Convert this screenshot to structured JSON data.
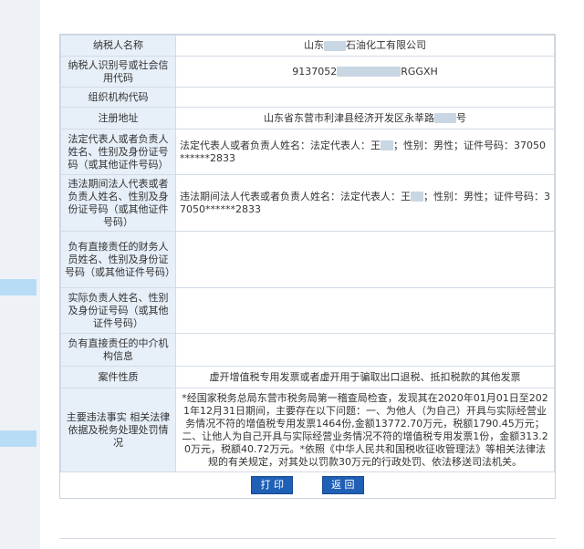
{
  "rows": [
    {
      "label": "纳税人名称",
      "value_a": "山东",
      "value_b": "石油化工有限公司"
    },
    {
      "label": "纳税人识别号或社会信用代码",
      "value_a": "9137052",
      "value_b": "RGGXH"
    },
    {
      "label": "组织机构代码",
      "value": ""
    },
    {
      "label": "注册地址",
      "value_a": "山东省东营市利津县经济开发区永莘路",
      "value_b": "号"
    },
    {
      "label": "法定代表人或者负责人姓名、性别及身份证号码（或其他证件号码）",
      "value_a": "法定代表人或者负责人姓名：法定代表人：王",
      "value_b": "；性别：男性；证件号码：37050******2833"
    },
    {
      "label": "违法期间法人代表或者负责人姓名、性别及身份证号码（或其他证件号码）",
      "value_a": "违法期间法人代表或者负责人姓名：法定代表人：王",
      "value_b": "；性别：男性；证件号码：37050******2833"
    },
    {
      "label": "负有直接责任的财务人员姓名、性别及身份证号码（或其他证件号码）",
      "value": ""
    },
    {
      "label": "实际负责人姓名、性别及身份证号码（或其他证件号码）",
      "value": ""
    },
    {
      "label": "负有直接责任的中介机构信息",
      "value": ""
    },
    {
      "label": "案件性质",
      "value": "虚开增值税专用发票或者虚开用于骗取出口退税、抵扣税款的其他发票"
    },
    {
      "label": "主要违法事实 相关法律依据及税务处理处罚情况",
      "value": "*经国家税务总局东营市税务局第一稽查局检查，发现其在2020年01月01日至2021年12月31日期间，主要存在以下问题：一、为他人（为自己）开具与实际经营业务情况不符的增值税专用发票1464份,金额13772.70万元，税额1790.45万元；二、让他人为自己开具与实际经营业务情况不符的增值税专用发票1份，金额313.20万元，税额40.72万元。*依照《中华人民共和国税收征收管理法》等相关法律法规的有关规定，对其处以罚款30万元的行政处罚、依法移送司法机关。"
    }
  ],
  "buttons": {
    "print": "打 印",
    "back": "返 回"
  }
}
